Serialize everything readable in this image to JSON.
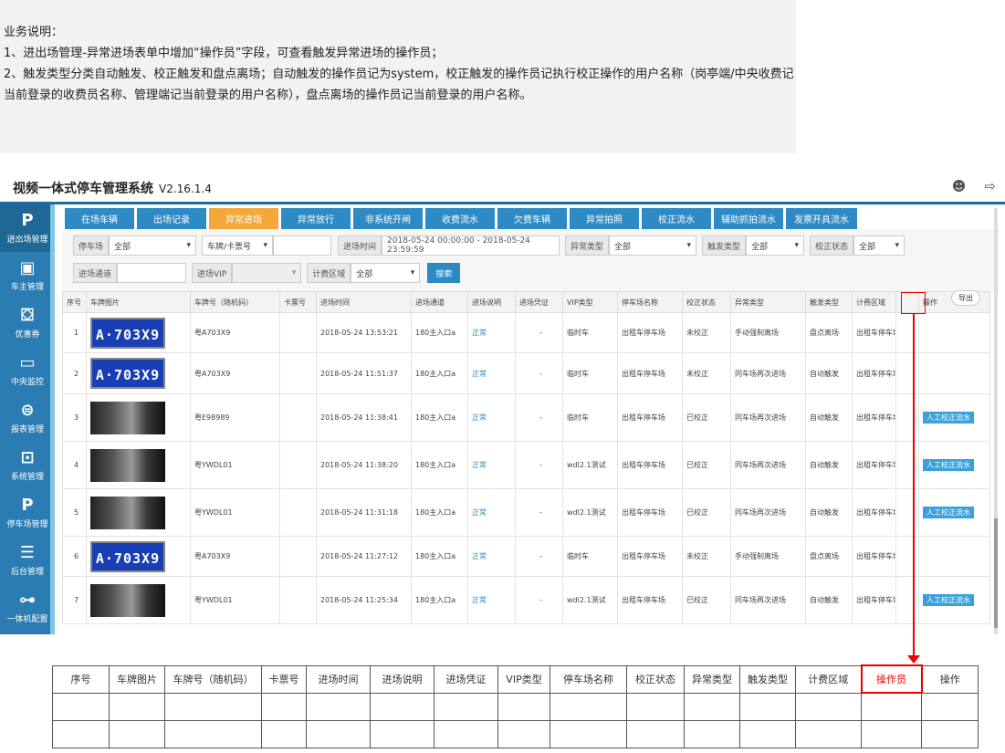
{
  "note": {
    "lines": [
      "业务说明：",
      "1、进出场管理-异常进场表单中增加“操作员”字段，可查看触发异常进场的操作员；",
      "2、触发类型分类自动触发、校正触发和盘点离场；自动触发的操作员记为system，校正触发的操作员记执行校正操作的用户名称（岗亭端/中央收费记当前登录的收费员名称、管理端记当前登录的用户名称），盘点离场的操作员记当前登录的用户名称。"
    ]
  },
  "app": {
    "title": "视频一体式停车管理系统",
    "version": "V2.16.1.4",
    "icons": [
      "user-icon",
      "logout-icon"
    ]
  },
  "sidebar": {
    "items": [
      {
        "icon": "P",
        "label": "进出场管理"
      },
      {
        "icon": "▣",
        "label": "车主管理"
      },
      {
        "icon": "⛋",
        "label": "优惠券"
      },
      {
        "icon": "▭",
        "label": "中央监控"
      },
      {
        "icon": "⊜",
        "label": "报表管理"
      },
      {
        "icon": "⊡",
        "label": "系统管理"
      },
      {
        "icon": "P",
        "label": "停车场管理"
      },
      {
        "icon": "☰",
        "label": "后台管理"
      },
      {
        "icon": "⊶",
        "label": "一体机配置"
      }
    ]
  },
  "tabs": [
    "在场车辆",
    "出场记录",
    "异常进场",
    "异常放行",
    "非系统开闸",
    "收费流水",
    "欠费车辆",
    "异常拍照",
    "校正流水",
    "辅助抓拍流水",
    "发票开具流水"
  ],
  "active_tab": 2,
  "filters": {
    "parking_label": "停车场",
    "parking_value": "全部",
    "plate_type_value": "车牌/卡票号",
    "time_label": "进场时间",
    "time_value": "2018-05-24 00:00:00 - 2018-05-24 23:59:59",
    "abn_label": "异常类型",
    "abn_value": "全部",
    "trig_label": "触发类型",
    "trig_value": "全部",
    "corr_label": "校正状态",
    "corr_value": "全部",
    "lane_label": "进场通道",
    "lane_value": "",
    "vip_label": "进场VIP",
    "vip_value": "",
    "zone_label": "计费区域",
    "zone_value": "全部",
    "search_label": "搜索",
    "export_label": "导出"
  },
  "table": {
    "headers": [
      "序号",
      "车牌图片",
      "车牌号（随机码）",
      "卡票号",
      "进场时间",
      "进场通道",
      "进场说明",
      "进场凭证",
      "VIP类型",
      "停车场名称",
      "校正状态",
      "异常类型",
      "触发类型",
      "计费区域",
      "",
      "操作"
    ],
    "rows": [
      {
        "no": "1",
        "img": "plate",
        "img_text": "A·703X9",
        "plate": "粤A703X9",
        "card": "",
        "time": "2018-05-24 13:53:21",
        "lane": "180主入口a",
        "desc": "正常",
        "cert": "-",
        "vip": "临时车",
        "park": "出租车停车场",
        "corr": "未校正",
        "abn": "手动强制离场",
        "trig": "盘点离场",
        "zone": "出租车停车场",
        "op": "",
        "action": ""
      },
      {
        "no": "2",
        "img": "plate",
        "img_text": "A·703X9",
        "plate": "粤A703X9",
        "card": "",
        "time": "2018-05-24 11:51:37",
        "lane": "180主入口a",
        "desc": "正常",
        "cert": "-",
        "vip": "临时车",
        "park": "出租车停车场",
        "corr": "未校正",
        "abn": "同车场再次进场",
        "trig": "自动触发",
        "zone": "出租车停车场",
        "op": "",
        "action": ""
      },
      {
        "no": "3",
        "img": "photo",
        "img_text": "",
        "plate": "粤E98989",
        "card": "",
        "time": "2018-05-24 11:38:41",
        "lane": "180主入口a",
        "desc": "正常",
        "cert": "-",
        "vip": "临时车",
        "park": "出租车停车场",
        "corr": "已校正",
        "abn": "同车场再次进场",
        "trig": "自动触发",
        "zone": "出租车停车场",
        "op": "",
        "action": "人工校正流水"
      },
      {
        "no": "4",
        "img": "photo",
        "img_text": "",
        "plate": "粤YWDL01",
        "card": "",
        "time": "2018-05-24 11:38:20",
        "lane": "180主入口a",
        "desc": "正常",
        "cert": "-",
        "vip": "wdl2.1测试",
        "park": "出租车停车场",
        "corr": "已校正",
        "abn": "同车场再次进场",
        "trig": "自动触发",
        "zone": "出租车停车场",
        "op": "",
        "action": "人工校正流水"
      },
      {
        "no": "5",
        "img": "photo",
        "img_text": "",
        "plate": "粤YWDL01",
        "card": "",
        "time": "2018-05-24 11:31:18",
        "lane": "180主入口a",
        "desc": "正常",
        "cert": "-",
        "vip": "wdl2.1测试",
        "park": "出租车停车场",
        "corr": "已校正",
        "abn": "同车场再次进场",
        "trig": "自动触发",
        "zone": "出租车停车场",
        "op": "",
        "action": "人工校正流水"
      },
      {
        "no": "6",
        "img": "plate",
        "img_text": "A·703X9",
        "plate": "粤A703X9",
        "card": "",
        "time": "2018-05-24 11:27:12",
        "lane": "180主入口a",
        "desc": "正常",
        "cert": "-",
        "vip": "临时车",
        "park": "出租车停车场",
        "corr": "未校正",
        "abn": "手动强制离场",
        "trig": "盘点离场",
        "zone": "出租车停车场",
        "op": "",
        "action": ""
      },
      {
        "no": "7",
        "img": "photo",
        "img_text": "",
        "plate": "粤YWDL01",
        "card": "",
        "time": "2018-05-24 11:25:34",
        "lane": "180主入口a",
        "desc": "正常",
        "cert": "-",
        "vip": "wdl2.1测试",
        "park": "出租车停车场",
        "corr": "已校正",
        "abn": "同车场再次进场",
        "trig": "自动触发",
        "zone": "出租车停车场",
        "op": "",
        "action": "人工校正流水"
      }
    ]
  },
  "bottom_table": {
    "headers": [
      "序号",
      "车牌图片",
      "车牌号（随机码）",
      "卡票号",
      "进场时间",
      "进场说明",
      "进场凭证",
      "VIP类型",
      "停车场名称",
      "校正状态",
      "异常类型",
      "触发类型",
      "计费区域",
      "操作员",
      "操作"
    ],
    "highlight": 13,
    "empty_rows": 2
  },
  "colors": {
    "sidebar": "#2a7cb2",
    "tab": "#2d8ac4",
    "tab_active": "#f5a73a",
    "highlight": "#e00000"
  }
}
